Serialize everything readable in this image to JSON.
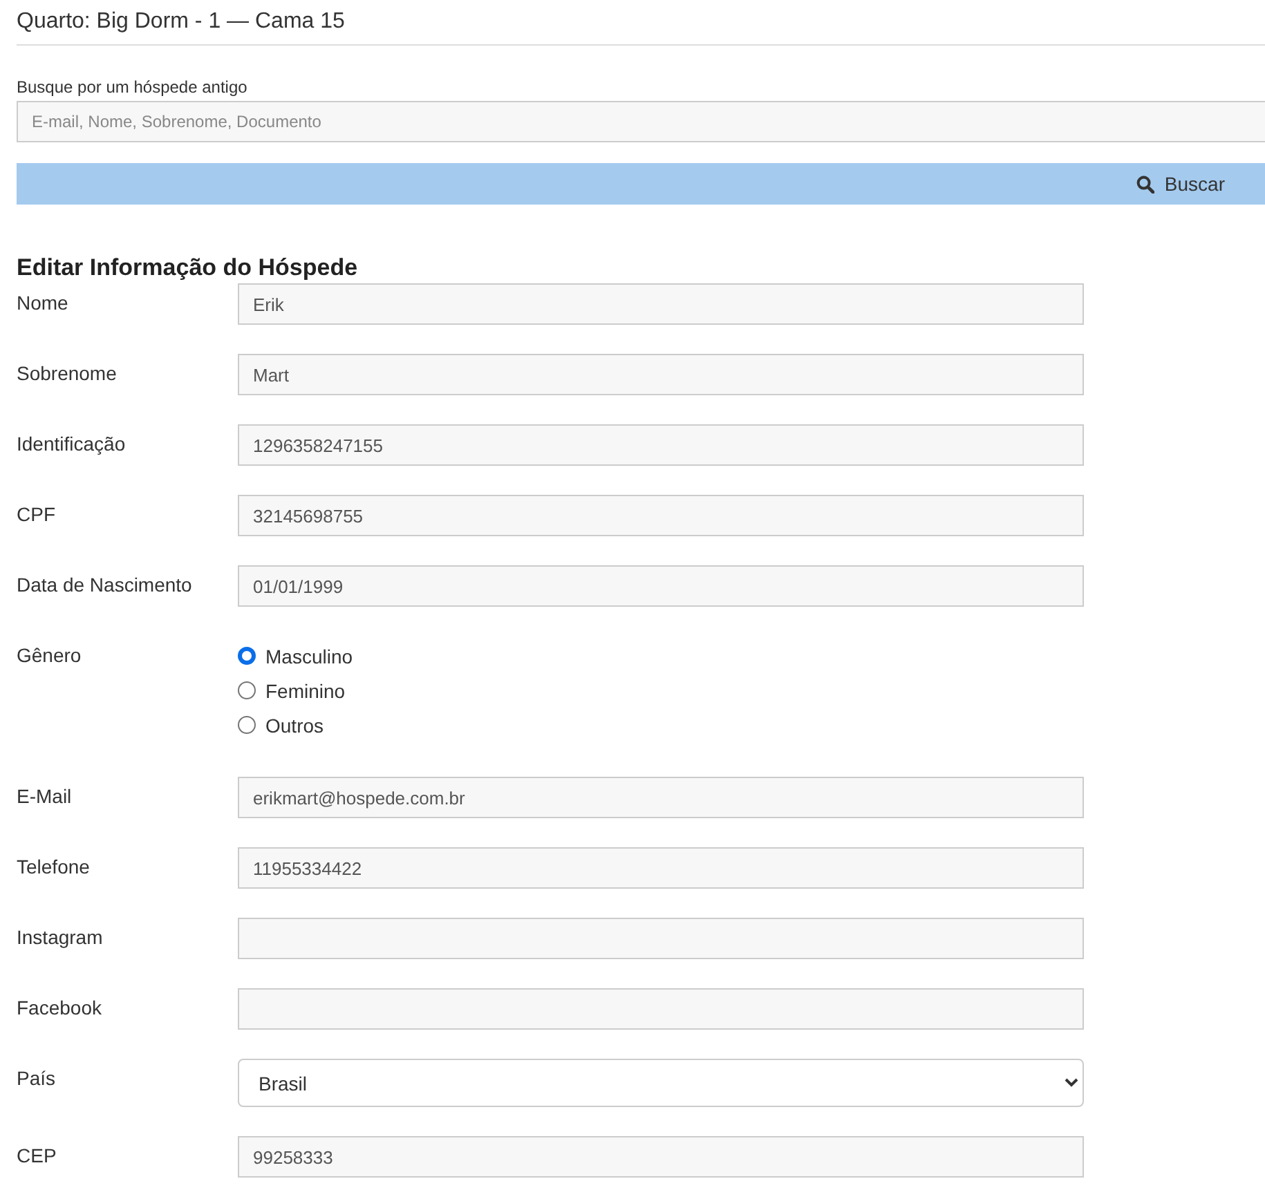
{
  "title": "Quarto: Big Dorm - 1 — Cama 15",
  "search": {
    "label": "Busque por um hóspede antigo",
    "placeholder": "E-mail, Nome, Sobrenome, Documento",
    "button": "Buscar"
  },
  "form": {
    "heading": "Editar Informação do Hóspede",
    "fields": [
      {
        "kind": "text",
        "label": "Nome",
        "value": "Erik"
      },
      {
        "kind": "text",
        "label": "Sobrenome",
        "value": "Mart"
      },
      {
        "kind": "text",
        "label": "Identificação",
        "value": "1296358247155"
      },
      {
        "kind": "text",
        "label": "CPF",
        "value": "32145698755"
      },
      {
        "kind": "text",
        "label": "Data de Nascimento",
        "value": "01/01/1999"
      },
      {
        "kind": "radio",
        "label": "Gênero",
        "options": [
          {
            "label": "Masculino",
            "selected": true
          },
          {
            "label": "Feminino",
            "selected": false
          },
          {
            "label": "Outros",
            "selected": false
          }
        ]
      },
      {
        "kind": "text",
        "label": "E-Mail",
        "value": "erikmart@hospede.com.br"
      },
      {
        "kind": "text",
        "label": "Telefone",
        "value": "11955334422"
      },
      {
        "kind": "text",
        "label": "Instagram"
      },
      {
        "kind": "text",
        "label": "Facebook"
      },
      {
        "kind": "select",
        "label": "País",
        "value": "Brasil"
      },
      {
        "kind": "text",
        "label": "CEP",
        "value": "99258333"
      }
    ]
  }
}
